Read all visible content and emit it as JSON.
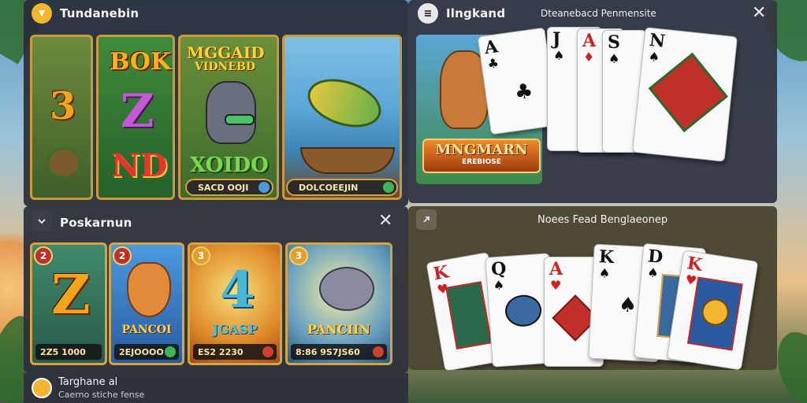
{
  "top_left": {
    "title": "Tundanebin",
    "slot_symbols": [
      "3",
      "BOK",
      "Z",
      "ND",
      "MGGAID",
      "VIDNEBD",
      "XOIDO"
    ],
    "pill_1": "SACD OOJI",
    "pill_2": "DOLCOEEJIN"
  },
  "bottom_left": {
    "title": "Poskarnun",
    "tiles": [
      {
        "badge": "2",
        "symbol": "Z",
        "amount": "2Z5 1000"
      },
      {
        "badge": "2",
        "name": "PANCOI",
        "amount": "2EJOOOO"
      },
      {
        "badge": "3",
        "symbol": "4",
        "name": "JGASP",
        "amount": "ES2  2230"
      },
      {
        "badge": "3",
        "name": "PANCIIN",
        "amount": "8:86 9S7JS60"
      }
    ]
  },
  "footer": {
    "title": "Targhane al",
    "subtitle": "Caerno stiche fense"
  },
  "top_right": {
    "title": "Ilngkand",
    "subtitle": "Dteanebacd Penmensite",
    "logo_text": "MNGMARN",
    "logo_sub": "EREBIOSE",
    "cards": [
      {
        "rank": "A",
        "suit": "♣",
        "color": "#111"
      },
      {
        "rank": "J",
        "suit": "♠",
        "color": "#111"
      },
      {
        "rank": "A",
        "suit": "♦",
        "color": "#c22"
      },
      {
        "rank": "S",
        "suit": "♠",
        "color": "#111"
      },
      {
        "rank": "N",
        "suit": "♠",
        "color": "#111"
      }
    ]
  },
  "bottom_right": {
    "title": "Noees Fead Benglaeonep",
    "cards": [
      {
        "rank": "K",
        "suit": "♥",
        "color": "#c22"
      },
      {
        "rank": "Q",
        "suit": "♠",
        "color": "#111"
      },
      {
        "rank": "A",
        "suit": "♥",
        "color": "#c22"
      },
      {
        "rank": "K",
        "suit": "♠",
        "color": "#111"
      },
      {
        "rank": "D",
        "suit": "♠",
        "color": "#111"
      },
      {
        "rank": "K",
        "suit": "♥",
        "color": "#c22"
      }
    ]
  },
  "icons": {
    "top_left": "coin-icon",
    "top_right": "menu-icon",
    "bottom_left": "chevron-icon",
    "bottom_right": "collapse-icon",
    "close": "close-icon"
  },
  "colors": {
    "gold": "#d3a346",
    "panel_dark": "#2c303a",
    "panel_olive": "#4f4a35"
  }
}
